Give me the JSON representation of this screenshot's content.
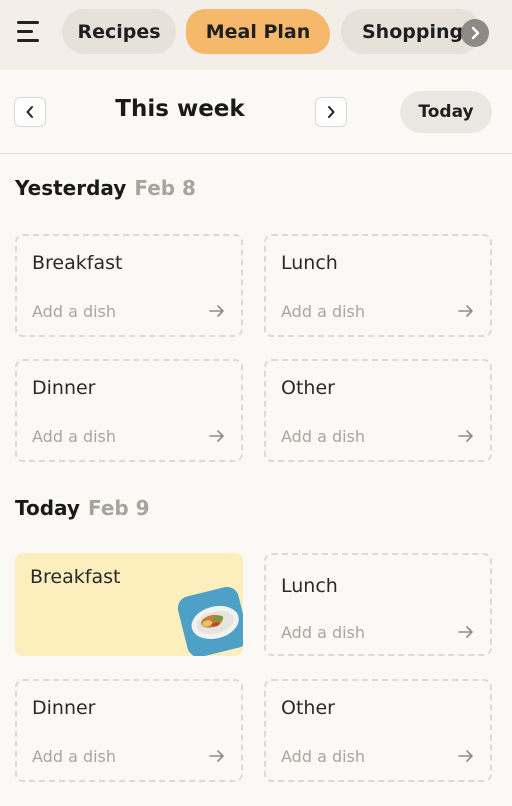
{
  "nav": {
    "menu_icon": "hamburger-menu-icon",
    "tabs": [
      {
        "label": "Recipes",
        "active": false
      },
      {
        "label": "Meal Plan",
        "active": true
      },
      {
        "label": "Shopping",
        "active": false
      }
    ],
    "more_icon": "chevron-right-icon"
  },
  "week": {
    "title": "This week",
    "today_label": "Today"
  },
  "days": [
    {
      "name": "Yesterday",
      "date": "Feb 8",
      "meals": [
        {
          "label": "Breakfast",
          "placeholder": "Add a dish"
        },
        {
          "label": "Lunch",
          "placeholder": "Add a dish"
        },
        {
          "label": "Dinner",
          "placeholder": "Add a dish"
        },
        {
          "label": "Other",
          "placeholder": "Add a dish"
        }
      ]
    },
    {
      "name": "Today",
      "date": "Feb 9",
      "meals": [
        {
          "label": "Breakfast",
          "has_dish": true
        },
        {
          "label": "Lunch",
          "placeholder": "Add a dish"
        },
        {
          "label": "Dinner",
          "placeholder": "Add a dish"
        },
        {
          "label": "Other",
          "placeholder": "Add a dish"
        }
      ]
    }
  ],
  "colors": {
    "background": "#fbf9f5",
    "active_tab": "#f6b86a",
    "filled_card": "#fdeebd",
    "dish_thumb": "#4fa0c6"
  }
}
